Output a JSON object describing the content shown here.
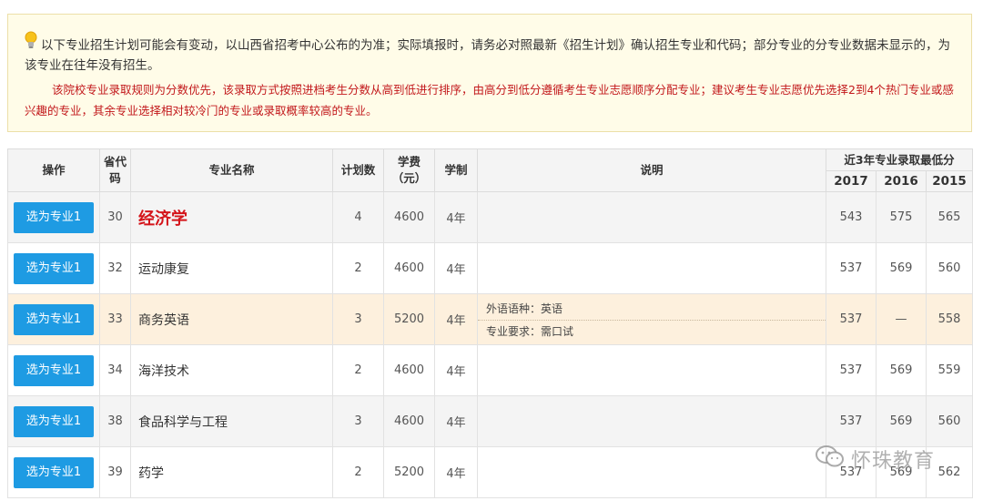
{
  "notice": {
    "line1": "以下专业招生计划可能会有变动，以山西省招考中心公布的为准；实际填报时，请务必对照最新《招生计划》确认招生专业和代码；部分专业的分专业数据未显示的，为该专业在往年没有招生。",
    "line2": "该院校专业录取规则为分数优先，该录取方式按照进档考生分数从高到低进行排序，由高分到低分遵循考生专业志愿顺序分配专业；建议考生专业志愿优先选择2到4个热门专业或感兴趣的专业，其余专业选择相对较冷门的专业或录取概率较高的专业。"
  },
  "table": {
    "headers": {
      "op": "操作",
      "code": "省代码",
      "name": "专业名称",
      "plan": "计划数",
      "fee": "学费（元）",
      "years": "学制",
      "note": "说明",
      "scores": "近3年专业录取最低分",
      "y2017": "2017",
      "y2016": "2016",
      "y2015": "2015"
    },
    "button_label": "选为专业1",
    "rows": [
      {
        "code": "30",
        "name": "经济学",
        "plan": "4",
        "fee": "4600",
        "years": "4年",
        "notes": [],
        "s2017": "543",
        "s2016": "575",
        "s2015": "565"
      },
      {
        "code": "32",
        "name": "运动康复",
        "plan": "2",
        "fee": "4600",
        "years": "4年",
        "notes": [],
        "s2017": "537",
        "s2016": "569",
        "s2015": "560"
      },
      {
        "code": "33",
        "name": "商务英语",
        "plan": "3",
        "fee": "5200",
        "years": "4年",
        "notes": [
          "外语语种：英语",
          "专业要求：需口试"
        ],
        "s2017": "537",
        "s2016": "—",
        "s2015": "558"
      },
      {
        "code": "34",
        "name": "海洋技术",
        "plan": "2",
        "fee": "4600",
        "years": "4年",
        "notes": [],
        "s2017": "537",
        "s2016": "569",
        "s2015": "559"
      },
      {
        "code": "38",
        "name": "食品科学与工程",
        "plan": "3",
        "fee": "4600",
        "years": "4年",
        "notes": [],
        "s2017": "537",
        "s2016": "569",
        "s2015": "560"
      },
      {
        "code": "39",
        "name": "药学",
        "plan": "2",
        "fee": "5200",
        "years": "4年",
        "notes": [],
        "s2017": "537",
        "s2016": "569",
        "s2015": "562"
      }
    ]
  },
  "watermark": {
    "text": "怀珠教育",
    "icon": "wechat-icon"
  },
  "colors": {
    "button": "#1e9be3",
    "highlight_row": "#fdf0dd",
    "notice_red": "#c2181b",
    "big_name": "#d4141a"
  }
}
